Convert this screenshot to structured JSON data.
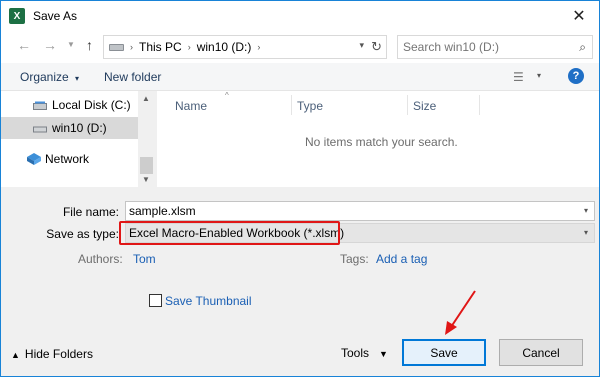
{
  "window": {
    "title": "Save As",
    "app_icon": "X",
    "accent": "#1883d7"
  },
  "address": {
    "crumbs": [
      "This PC",
      "win10 (D:)"
    ],
    "search_placeholder": "Search win10 (D:)"
  },
  "toolbar": {
    "organize_label": "Organize",
    "new_folder_label": "New folder",
    "help_label": "?"
  },
  "nav": {
    "items": [
      {
        "label": "Local Disk (C:)",
        "icon": "local-disk-icon",
        "selected": false
      },
      {
        "label": "win10 (D:)",
        "icon": "drive-icon",
        "selected": true
      },
      {
        "label": "Network",
        "icon": "network-icon",
        "selected": false
      }
    ]
  },
  "content": {
    "columns": [
      "Name",
      "Type",
      "Size"
    ],
    "empty_message": "No items match your search."
  },
  "form": {
    "file_name_label": "File name:",
    "file_name_value": "sample.xlsm",
    "save_type_label": "Save as type:",
    "save_type_value": "Excel Macro-Enabled Workbook (*.xlsm)",
    "authors_label": "Authors:",
    "authors_value": "Tom",
    "tags_label": "Tags:",
    "tags_value": "Add a tag",
    "thumbnail_label": "Save Thumbnail"
  },
  "footer": {
    "hide_folders_label": "Hide Folders",
    "tools_label": "Tools",
    "save_label": "Save",
    "cancel_label": "Cancel"
  },
  "colors": {
    "highlight": "#e01616",
    "link": "#1a5fb4",
    "primary_border": "#0078d7"
  }
}
